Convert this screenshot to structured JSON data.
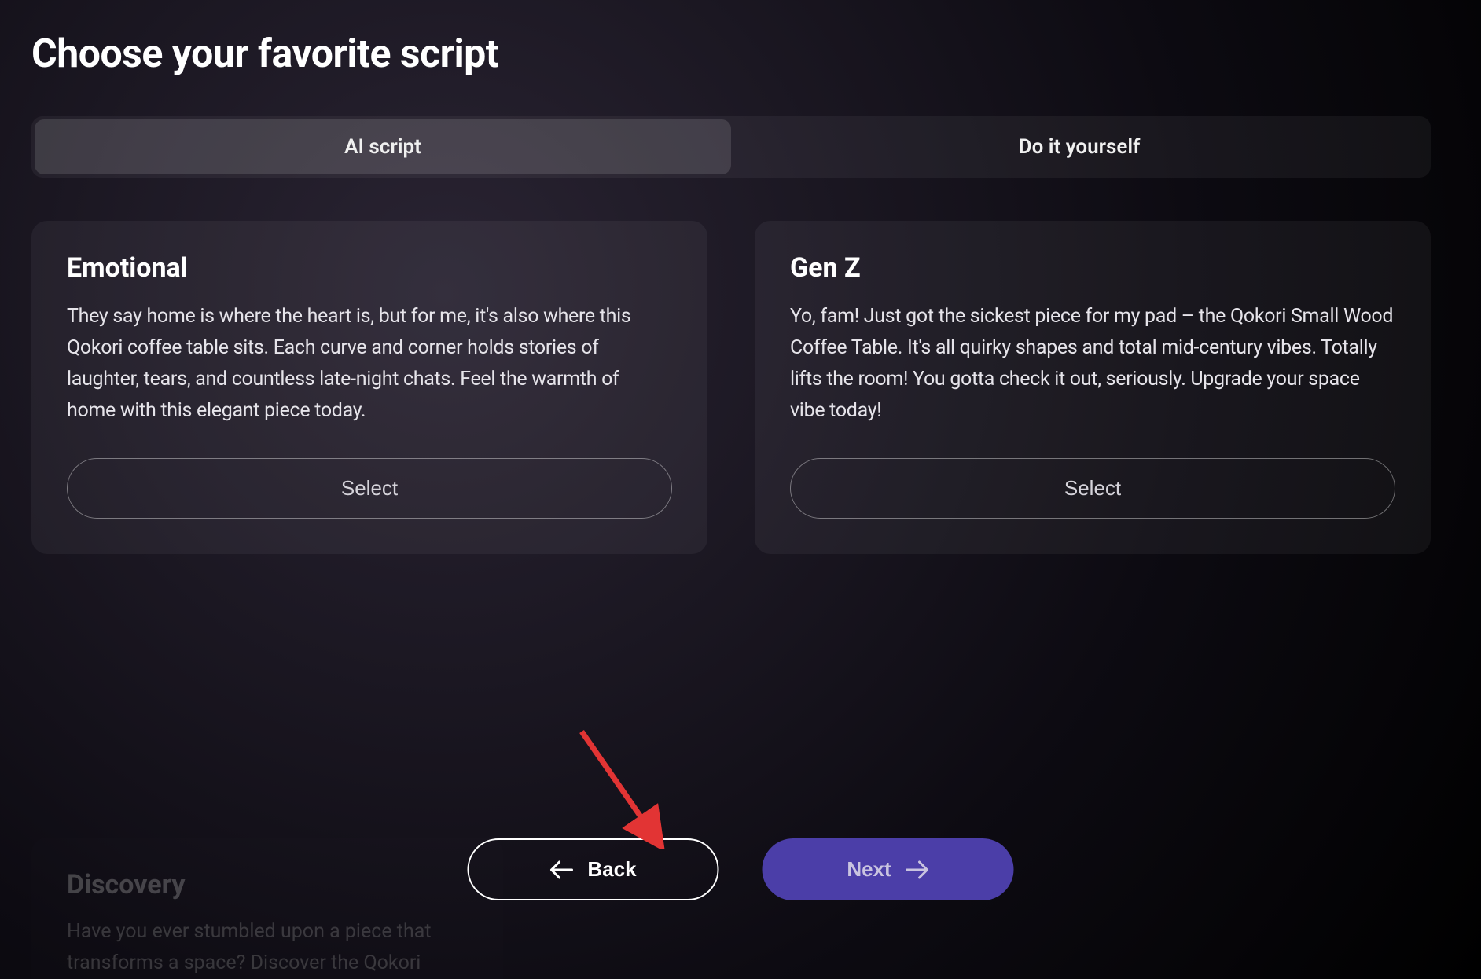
{
  "page": {
    "title": "Choose your favorite script"
  },
  "tabs": [
    {
      "label": "AI script",
      "active": true
    },
    {
      "label": "Do it yourself",
      "active": false
    }
  ],
  "scripts": [
    {
      "title": "Emotional",
      "body": "They say home is where the heart is, but for me, it's also where this Qokori coffee table sits. Each curve and corner holds stories of laughter, tears, and countless late-night chats. Feel the warmth of home with this elegant piece today.",
      "cta": "Select"
    },
    {
      "title": "Gen Z",
      "body": "Yo, fam! Just got the sickest piece for my pad – the Qokori Small Wood Coffee Table. It's all quirky shapes and total mid-century vibes. Totally lifts the room! You gotta check it out, seriously. Upgrade your space vibe today!",
      "cta": "Select"
    }
  ],
  "ghost": {
    "title": "Discovery",
    "body": "Have you ever stumbled upon a piece that transforms a space? Discover the Qokori"
  },
  "nav": {
    "back": "Back",
    "next": "Next"
  },
  "colors": {
    "next_bg": "#4b3ea8",
    "arrow": "#e23434"
  }
}
